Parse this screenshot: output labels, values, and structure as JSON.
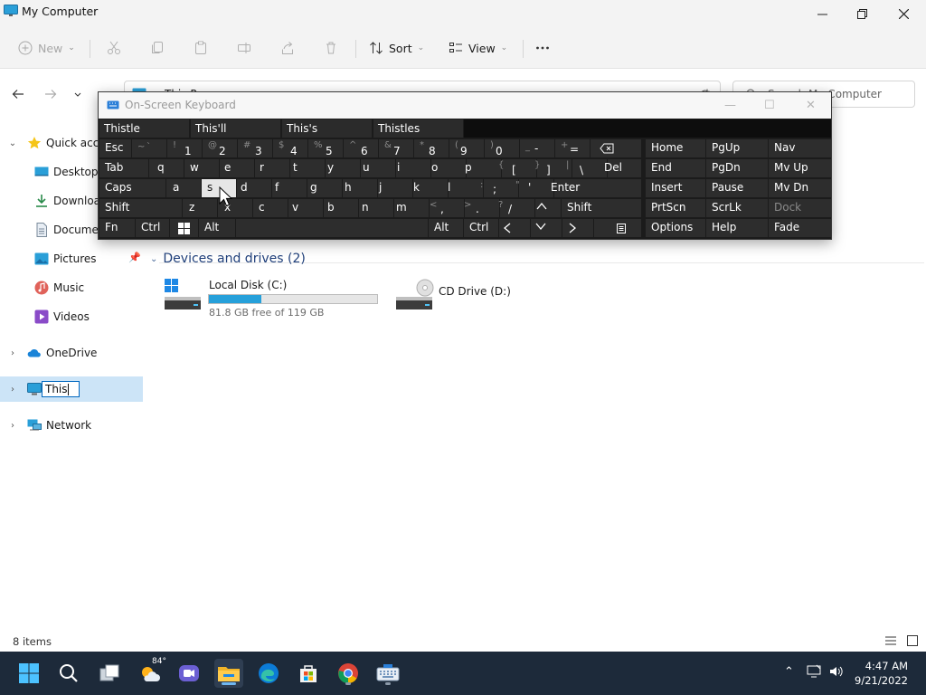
{
  "window": {
    "title": "My Computer",
    "minimize_icon": "minimize-icon",
    "maximize_icon": "restore-icon",
    "close_icon": "close-icon"
  },
  "command_bar": {
    "new_label": "New",
    "sort_label": "Sort",
    "view_label": "View",
    "disabled_icons": [
      "cut-icon",
      "copy-icon",
      "paste-icon",
      "rename-icon",
      "share-icon",
      "delete-icon"
    ],
    "more_icon": "more-icon"
  },
  "address_bar": {
    "path": "This P",
    "search_placeholder": "Search My Computer"
  },
  "sidebar": {
    "quick_access": "Quick access",
    "items": [
      {
        "label": "Desktop",
        "icon": "desktop-icon"
      },
      {
        "label": "Downloads",
        "icon": "downloads-icon"
      },
      {
        "label": "Documents",
        "icon": "documents-icon"
      },
      {
        "label": "Pictures",
        "icon": "pictures-icon"
      },
      {
        "label": "Music",
        "icon": "music-icon"
      },
      {
        "label": "Videos",
        "icon": "videos-icon"
      }
    ],
    "onedrive": "OneDrive",
    "rename_value": "This",
    "network": "Network"
  },
  "content": {
    "section_title": "Devices and drives (2)",
    "drives": [
      {
        "name": "Local Disk (C:)",
        "free_text": "81.8 GB free of 119 GB",
        "used_fraction": 0.31
      },
      {
        "name": "CD Drive (D:)"
      }
    ]
  },
  "status": {
    "item_count": "8 items"
  },
  "keyboard": {
    "title": "On-Screen Keyboard",
    "predictions": [
      "Thistle",
      "This'll",
      "This's",
      "Thistles"
    ],
    "row1": {
      "esc": "Esc",
      "numbers": [
        {
          "top": "~",
          "sub": "`",
          "main": ""
        },
        {
          "top": "!",
          "main": "1"
        },
        {
          "top": "@",
          "main": "2"
        },
        {
          "top": "#",
          "main": "3"
        },
        {
          "top": "$",
          "main": "4"
        },
        {
          "top": "%",
          "main": "5"
        },
        {
          "top": "^",
          "main": "6"
        },
        {
          "top": "&",
          "main": "7"
        },
        {
          "top": "*",
          "main": "8"
        },
        {
          "top": "(",
          "main": "9"
        },
        {
          "top": ")",
          "main": "0"
        },
        {
          "top": "_",
          "main": "-"
        },
        {
          "top": "+",
          "main": "="
        }
      ]
    },
    "row2": {
      "tab": "Tab",
      "letters": [
        "q",
        "w",
        "e",
        "r",
        "t",
        "y",
        "u",
        "i",
        "o",
        "p"
      ],
      "brace_open": "{",
      "bracket_open": "[",
      "brace_close": "}",
      "bracket_close": "]",
      "pipe": "|",
      "backslash": "\\",
      "del": "Del"
    },
    "row3": {
      "caps": "Caps",
      "letters": [
        "a",
        "s",
        "d",
        "f",
        "g",
        "h",
        "j",
        "k",
        "l"
      ],
      "colon": ":",
      "semicolon": ";",
      "quote": "\"",
      "apostrophe": "'",
      "enter": "Enter"
    },
    "row4": {
      "shift": "Shift",
      "letters": [
        "z",
        "x",
        "c",
        "v",
        "b",
        "n",
        "m"
      ],
      "lt": "<",
      "comma": ",",
      "gt": ">",
      "period": ".",
      "question": "?",
      "slash": "/",
      "shift_r": "Shift"
    },
    "row5": {
      "fn": "Fn",
      "ctrl": "Ctrl",
      "alt": "Alt",
      "alt_r": "Alt",
      "ctrl_r": "Ctrl"
    },
    "nav_keys": [
      [
        "Home",
        "PgUp",
        "Nav"
      ],
      [
        "End",
        "PgDn",
        "Mv Up"
      ],
      [
        "Insert",
        "Pause",
        "Mv Dn"
      ],
      [
        "PrtScn",
        "ScrLk",
        "Dock"
      ],
      [
        "Options",
        "Help",
        "Fade"
      ]
    ],
    "hovered_key": "s"
  },
  "taskbar": {
    "icons": [
      "start-icon",
      "search-icon",
      "task-view-icon",
      "weather-icon",
      "chat-icon",
      "file-explorer-icon",
      "edge-icon",
      "store-icon",
      "chrome-icon",
      "osk-app-icon"
    ],
    "weather_temp": "84°",
    "time": "4:47 AM",
    "date": "9/21/2022"
  }
}
